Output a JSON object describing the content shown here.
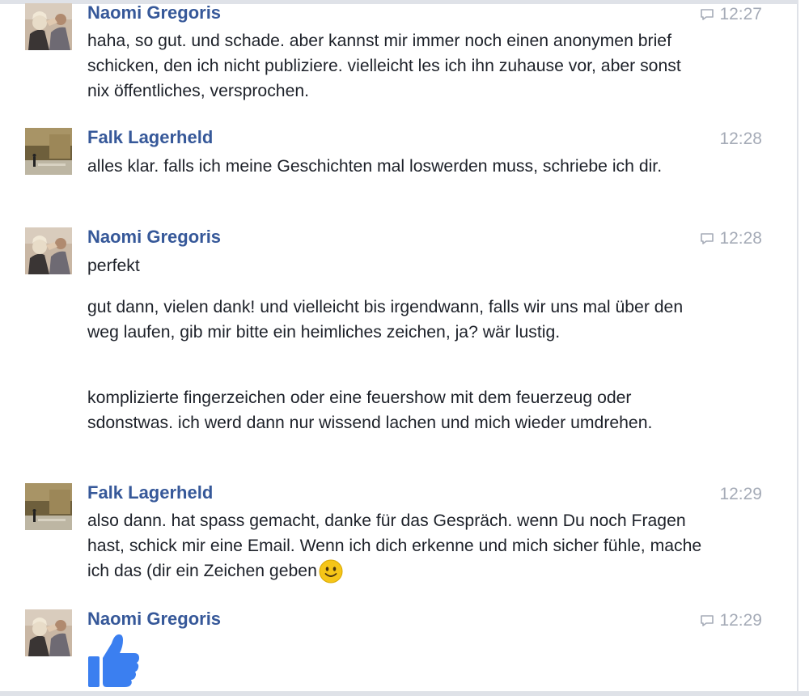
{
  "messages": [
    {
      "sender": "Naomi Gregoris",
      "time": "12:27",
      "has_comment_icon": true,
      "paragraphs": [
        "haha, so gut. und schade. aber kannst mir immer noch einen anonymen brief schicken, den ich nicht publiziere. vielleicht les ich ihn zuhause vor, aber sonst nix öffentliches, versprochen."
      ]
    },
    {
      "sender": "Falk Lagerheld",
      "time": "12:28",
      "has_comment_icon": false,
      "paragraphs": [
        "alles klar. falls ich meine Geschichten mal loswerden muss, schriebe ich dir."
      ]
    },
    {
      "sender": "Naomi Gregoris",
      "time": "12:28",
      "has_comment_icon": true,
      "paragraphs": [
        "perfekt",
        "gut dann, vielen dank! und vielleicht bis irgendwann, falls wir uns mal über den weg laufen, gib mir bitte ein heimliches zeichen, ja? wär lustig.",
        "komplizierte fingerzeichen oder eine feuershow mit dem feuerzeug oder sdonstwas. ich werd dann nur wissend lachen und mich wieder umdrehen."
      ]
    },
    {
      "sender": "Falk Lagerheld",
      "time": "12:29",
      "has_comment_icon": false,
      "paragraphs": [
        "also dann. hat spass gemacht, danke für das Gespräch. wenn Du noch Fragen hast, schick mir eine Email. Wenn ich dich erkenne und mich sicher fühle, mache ich das (dir ein Zeichen geben"
      ],
      "trailing_emoji": "smiley-emoji"
    },
    {
      "sender": "Naomi Gregoris",
      "time": "12:29",
      "has_comment_icon": true,
      "paragraphs": [],
      "sticker": "thumbs-up-icon"
    }
  ],
  "colors": {
    "sender_name": "#365899",
    "timestamp": "#a5abb7",
    "text": "#1d2129",
    "thumbs_up": "#3b7ff0",
    "smiley": "#f5c518"
  }
}
